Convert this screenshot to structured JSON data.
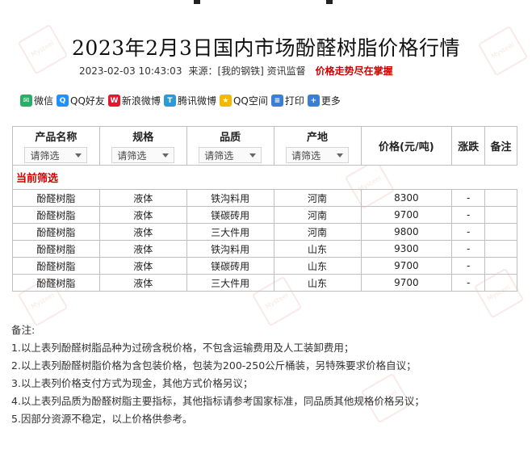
{
  "header": {
    "title": "2023年2月3日国内市场酚醛树脂价格行情",
    "datetime": "2023-02-03 10:43:03",
    "source": "来源：[我的钢铁] 资讯监督",
    "trend_link": "价格走势尽在掌握"
  },
  "share": {
    "items": [
      {
        "label": "微信",
        "icon": "wechat-icon",
        "color": "#2aae67"
      },
      {
        "label": "QQ好友",
        "icon": "qq-icon",
        "color": "#1e90ff"
      },
      {
        "label": "新浪微博",
        "icon": "weibo-icon",
        "color": "#e6162d"
      },
      {
        "label": "腾讯微博",
        "icon": "tencent-weibo-icon",
        "color": "#2b9bd6"
      },
      {
        "label": "QQ空间",
        "icon": "qzone-icon",
        "color": "#f5b800"
      },
      {
        "label": "打印",
        "icon": "print-icon",
        "color": "#3a7fd5"
      },
      {
        "label": "更多",
        "icon": "plus-icon",
        "color": "#3a7fd5"
      }
    ]
  },
  "table": {
    "headers": {
      "name": "产品名称",
      "spec": "规格",
      "quality": "品质",
      "origin": "产地",
      "price": "价格(元/吨)",
      "change": "涨跌",
      "remark": "备注"
    },
    "filter_placeholder": "请筛选",
    "current_filter_label": "当前筛选",
    "rows": [
      {
        "name": "酚醛树脂",
        "spec": "液体",
        "quality": "铁沟料用",
        "origin": "河南",
        "price": "8300",
        "change": "-",
        "remark": ""
      },
      {
        "name": "酚醛树脂",
        "spec": "液体",
        "quality": "镁碳砖用",
        "origin": "河南",
        "price": "9700",
        "change": "-",
        "remark": ""
      },
      {
        "name": "酚醛树脂",
        "spec": "液体",
        "quality": "三大件用",
        "origin": "河南",
        "price": "9800",
        "change": "-",
        "remark": ""
      },
      {
        "name": "酚醛树脂",
        "spec": "液体",
        "quality": "铁沟料用",
        "origin": "山东",
        "price": "9300",
        "change": "-",
        "remark": ""
      },
      {
        "name": "酚醛树脂",
        "spec": "液体",
        "quality": "镁碳砖用",
        "origin": "山东",
        "price": "9700",
        "change": "-",
        "remark": ""
      },
      {
        "name": "酚醛树脂",
        "spec": "液体",
        "quality": "三大件用",
        "origin": "山东",
        "price": "9700",
        "change": "-",
        "remark": ""
      }
    ]
  },
  "notes": {
    "heading": "备注:",
    "lines": [
      "1.以上表列酚醛树脂品种为过磅含税价格，不包含运输费用及人工装卸费用；",
      "2.以上表列酚醛树脂价格为含包装价格，包装为200-250公斤桶装，另特殊要求价格自议；",
      "3.以上表列价格支付方式为现金，其他方式价格另议；",
      "4.以上表列品质为酚醛树脂主要指标，其他指标请参考国家标准，同品质其他规格价格另议；",
      "5.因部分资源不稳定，以上价格供参考。"
    ]
  }
}
